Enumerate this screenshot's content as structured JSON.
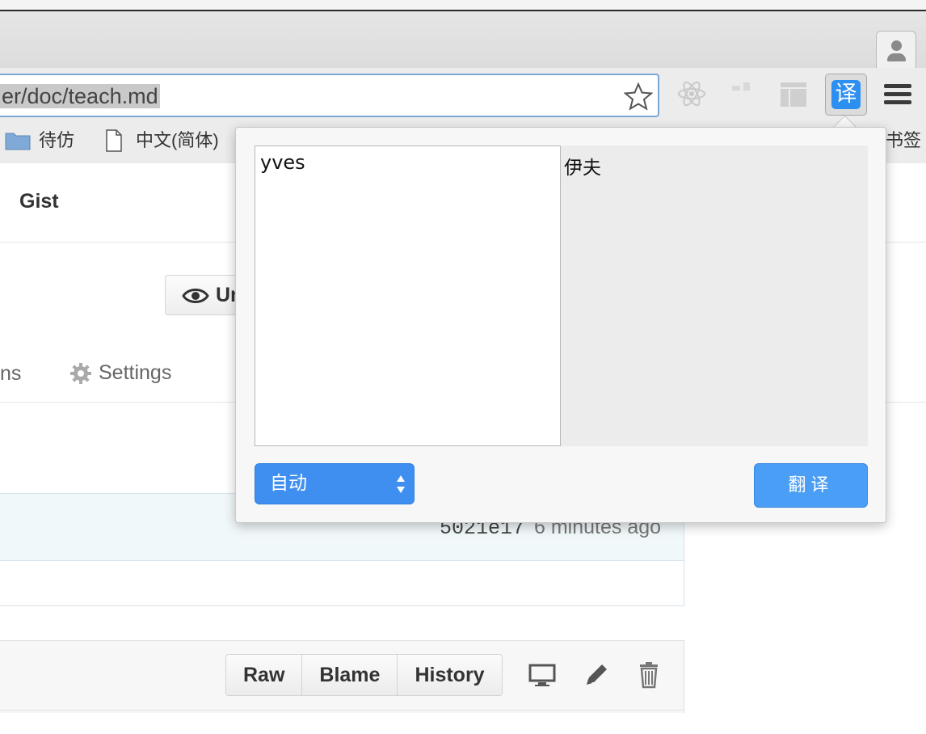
{
  "browser": {
    "address_bar": {
      "url": "er/doc/teach.md"
    },
    "extensions": {
      "translate_button_glyph": "译"
    },
    "bookmarks": [
      {
        "label": "待仿",
        "icon": "folder-icon"
      },
      {
        "label": "中文(简体)",
        "icon": "document-icon"
      }
    ],
    "bookmarks_trailing": "书签"
  },
  "page": {
    "header": {
      "gist_link": "Gist"
    },
    "watch_button": {
      "label": "Un"
    },
    "tabs": {
      "partial_tab": "ns",
      "settings": "Settings"
    },
    "commit": {
      "sha": "5021e17",
      "time": "6 minutes ago"
    },
    "file_actions": {
      "raw": "Raw",
      "blame": "Blame",
      "history": "History"
    }
  },
  "translate_popup": {
    "source_text": "yves",
    "result_text": "伊夫",
    "language_select": {
      "selected": "自动"
    },
    "translate_button": "翻译"
  },
  "colors": {
    "accent_blue": "#3f8ff1",
    "translate_button": "#4a9ef5",
    "commit_bar": "#f1f8fa"
  }
}
